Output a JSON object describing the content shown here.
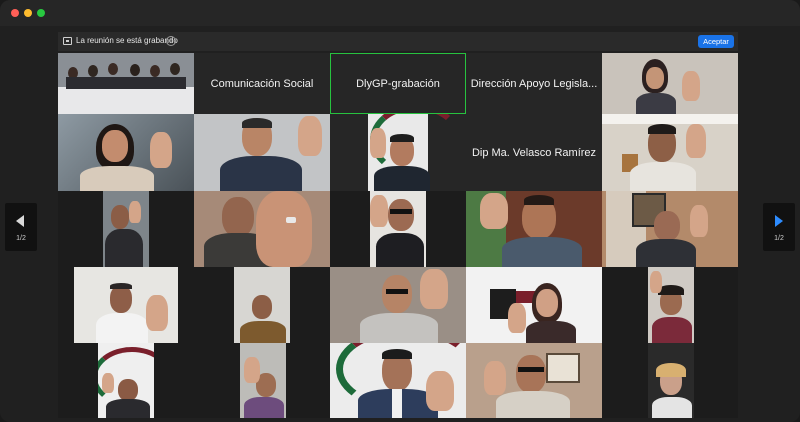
{
  "window": {
    "title": ""
  },
  "recording_bar": {
    "text": "La reunión se está grabando",
    "accept_label": "Aceptar",
    "info_glyph": "i",
    "icon": "recording-icon"
  },
  "tiles": {
    "comunicacion": "Comunicación Social",
    "dlygp": "DlyGP-grabación",
    "direccion": "Dirección Apoyo Legisla...",
    "velasco": "Dip Ma. Velasco Ramírez"
  },
  "nav": {
    "left_page": "1/2",
    "right_page": "1/2"
  },
  "colors": {
    "accent_blue": "#1a73e8",
    "active_speaker": "#27c23f",
    "tile_dark": "#262626"
  }
}
